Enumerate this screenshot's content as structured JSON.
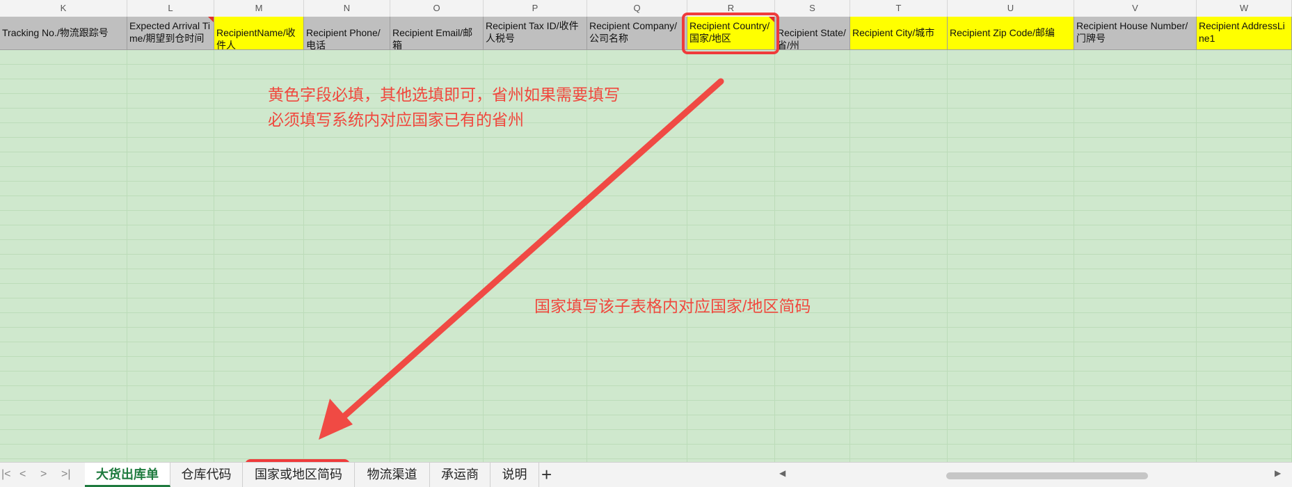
{
  "columns": [
    {
      "letter": "K",
      "header": "Tracking No./物流跟踪号",
      "required": false,
      "comment": false
    },
    {
      "letter": "L",
      "header": "Expected Arrival Time/期望到仓时间",
      "required": false,
      "comment": true
    },
    {
      "letter": "M",
      "header": "RecipientName/收件人",
      "required": true,
      "comment": false
    },
    {
      "letter": "N",
      "header": "Recipient Phone/电话",
      "required": false,
      "comment": false
    },
    {
      "letter": "O",
      "header": "Recipient Email/邮箱",
      "required": false,
      "comment": false
    },
    {
      "letter": "P",
      "header": "Recipient Tax ID/收件人税号",
      "required": false,
      "comment": false
    },
    {
      "letter": "Q",
      "header": "Recipient Company/公司名称",
      "required": false,
      "comment": false
    },
    {
      "letter": "R",
      "header": "Recipient Country/国家/地区",
      "required": true,
      "comment": true
    },
    {
      "letter": "S",
      "header": "Recipient State/省/州",
      "required": false,
      "comment": false
    },
    {
      "letter": "T",
      "header": "Recipient City/城市",
      "required": true,
      "comment": false
    },
    {
      "letter": "U",
      "header": "Recipient Zip Code/邮编",
      "required": true,
      "comment": false
    },
    {
      "letter": "V",
      "header": "Recipient House Number/门牌号",
      "required": false,
      "comment": false
    },
    {
      "letter": "W",
      "header": "Recipient AddressLine1",
      "required": true,
      "comment": false
    }
  ],
  "annotations": {
    "required_note_line1": "黄色字段必填，其他选填即可，省州如果需要填写",
    "required_note_line2": "必须填写系统内对应国家已有的省州",
    "country_note": "国家填写该子表格内对应国家/地区简码"
  },
  "sheet_tabs": [
    {
      "label": "大货出库单",
      "active": true
    },
    {
      "label": "仓库代码",
      "active": false
    },
    {
      "label": "国家或地区简码",
      "active": false,
      "highlighted": true
    },
    {
      "label": "物流渠道",
      "active": false
    },
    {
      "label": "承运商",
      "active": false
    },
    {
      "label": "说明",
      "active": false
    }
  ],
  "nav": {
    "first": "|<",
    "prev": "<",
    "next": ">",
    "last": ">|",
    "add": "+",
    "scroll_left": "◀",
    "scroll_right": "▶"
  },
  "colors": {
    "required": "#ffff00",
    "optional": "#bfbfbf",
    "annotation": "#f0473d",
    "active_tab": "#1e7a3e",
    "grid_bg": "#cfe8cd"
  }
}
